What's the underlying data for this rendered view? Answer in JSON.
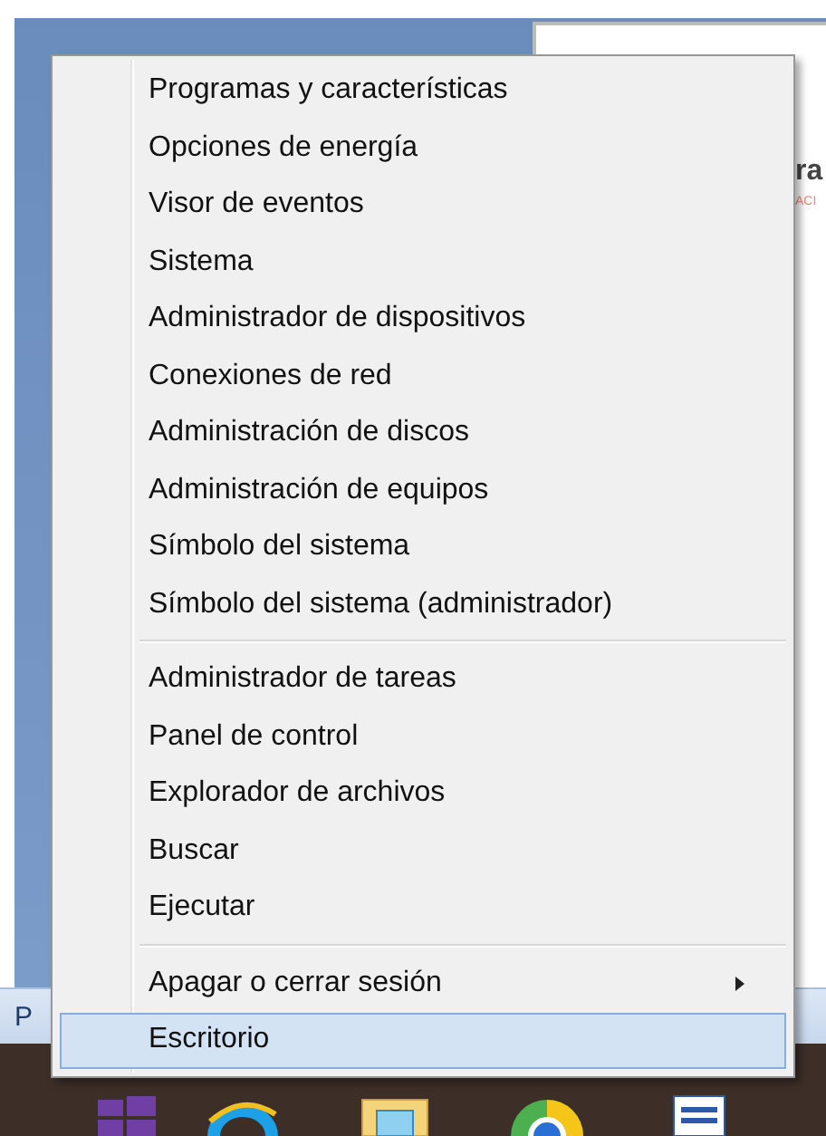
{
  "background": {
    "window_fragments": [
      {
        "text": "ra",
        "kind": "heading"
      },
      {
        "text": "ACI",
        "kind": "accent"
      }
    ],
    "side_label": "P"
  },
  "menu": {
    "groups": [
      {
        "items": [
          {
            "label": "Programas y características",
            "selected": false,
            "submenu": false
          },
          {
            "label": "Opciones de energía",
            "selected": false,
            "submenu": false
          },
          {
            "label": "Visor de eventos",
            "selected": false,
            "submenu": false
          },
          {
            "label": "Sistema",
            "selected": false,
            "submenu": false
          },
          {
            "label": "Administrador de dispositivos",
            "selected": false,
            "submenu": false
          },
          {
            "label": "Conexiones de red",
            "selected": false,
            "submenu": false
          },
          {
            "label": "Administración de discos",
            "selected": false,
            "submenu": false
          },
          {
            "label": "Administración de equipos",
            "selected": false,
            "submenu": false
          },
          {
            "label": "Símbolo del sistema",
            "selected": false,
            "submenu": false
          },
          {
            "label": "Símbolo del sistema (administrador)",
            "selected": false,
            "submenu": false
          }
        ]
      },
      {
        "items": [
          {
            "label": "Administrador de tareas",
            "selected": false,
            "submenu": false
          },
          {
            "label": "Panel de control",
            "selected": false,
            "submenu": false
          },
          {
            "label": "Explorador de archivos",
            "selected": false,
            "submenu": false
          },
          {
            "label": "Buscar",
            "selected": false,
            "submenu": false
          },
          {
            "label": "Ejecutar",
            "selected": false,
            "submenu": false
          }
        ]
      },
      {
        "items": [
          {
            "label": "Apagar o cerrar sesión",
            "selected": false,
            "submenu": true
          },
          {
            "label": "Escritorio",
            "selected": true,
            "submenu": false
          }
        ]
      }
    ]
  }
}
